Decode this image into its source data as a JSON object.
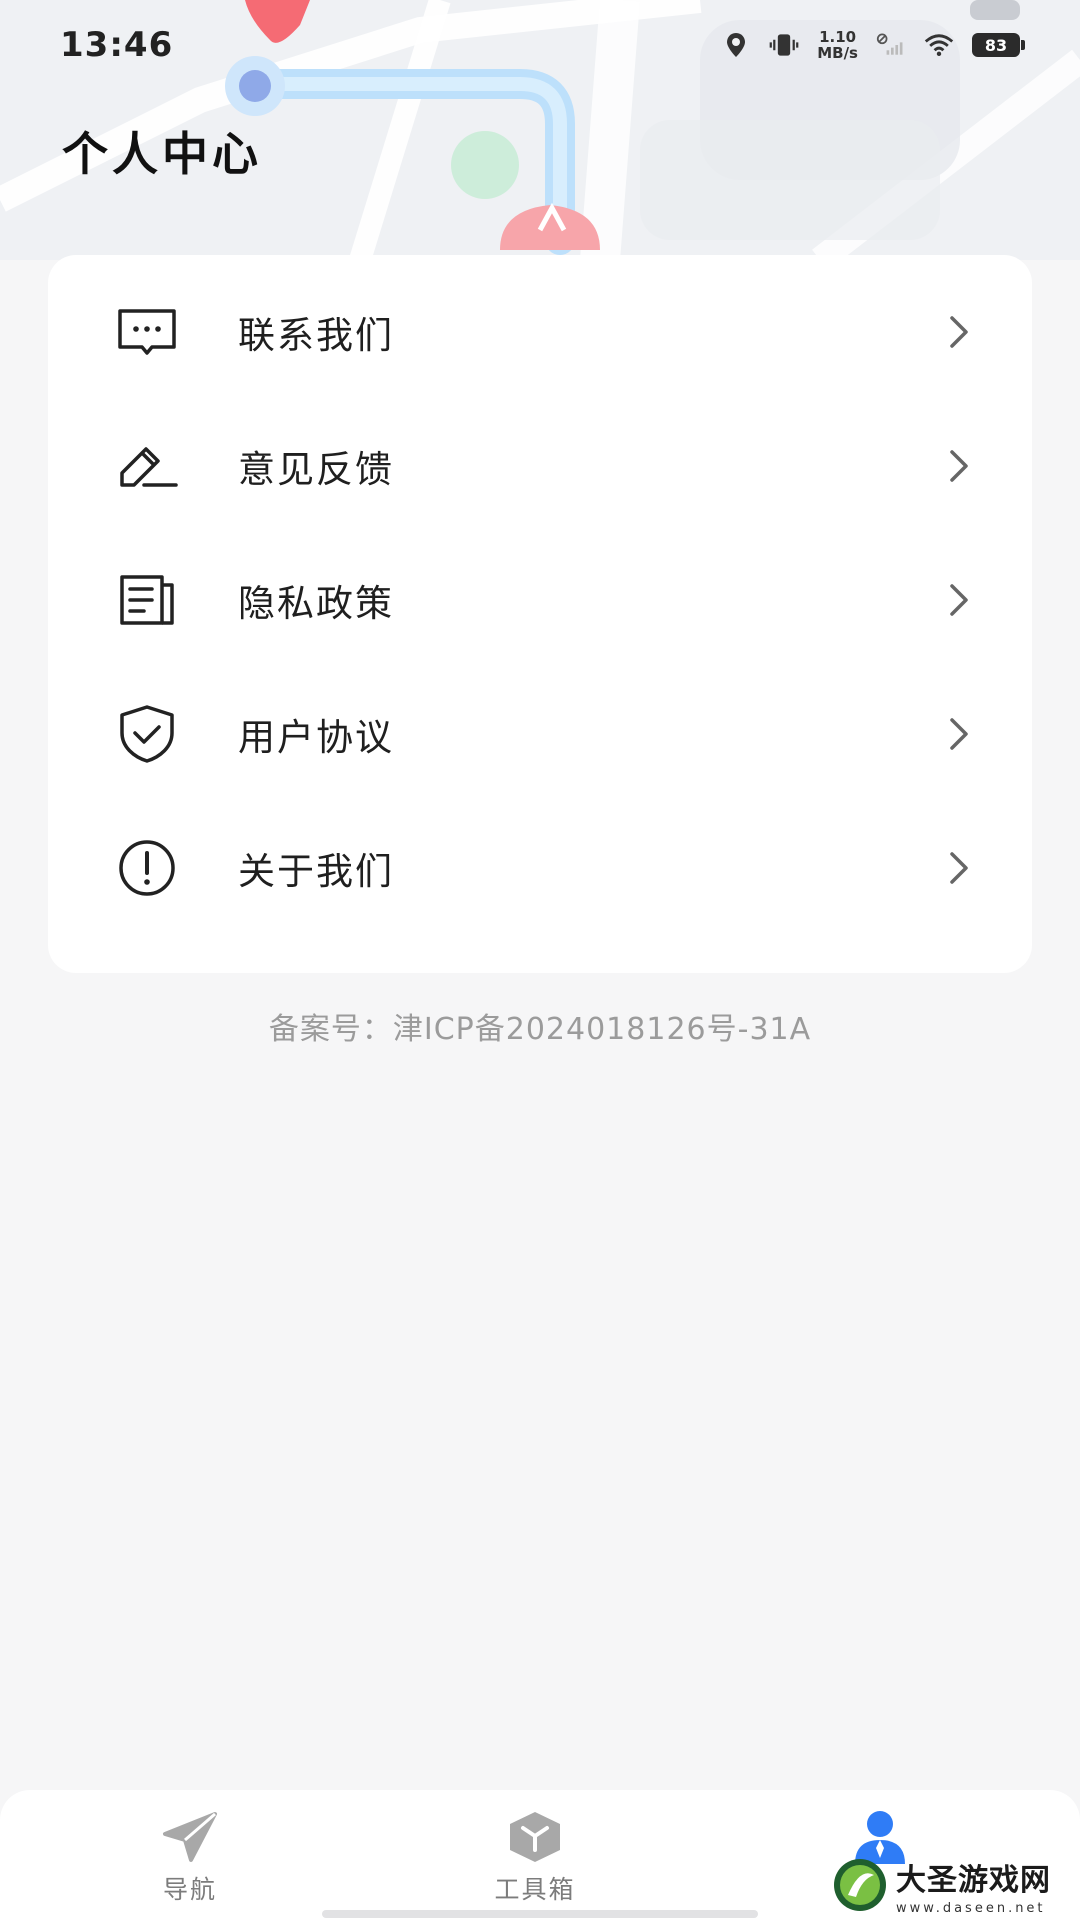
{
  "status_bar": {
    "time": "13:46",
    "net_speed_value": "1.10",
    "net_speed_unit": "MB/s",
    "battery": "83",
    "icons": [
      "location-icon",
      "vibrate-icon",
      "no-sim-signal-icon",
      "wifi-icon",
      "battery-icon"
    ]
  },
  "page": {
    "title": "个人中心"
  },
  "menu": {
    "items": [
      {
        "label": "联系我们",
        "icon": "message-icon"
      },
      {
        "label": "意见反馈",
        "icon": "edit-icon"
      },
      {
        "label": "隐私政策",
        "icon": "document-icon"
      },
      {
        "label": "用户协议",
        "icon": "shield-check-icon"
      },
      {
        "label": "关于我们",
        "icon": "info-exclamation-icon"
      }
    ]
  },
  "icp": "备案号：津ICP备2024018126号-31A",
  "bottom_nav": {
    "items": [
      {
        "label": "导航",
        "icon": "navigation-icon"
      },
      {
        "label": "工具箱",
        "icon": "toolbox-icon"
      },
      {
        "label": "",
        "icon": "profile-icon",
        "active": true
      }
    ]
  },
  "watermark": {
    "title": "大圣游戏网",
    "url": "www.daseen.net"
  },
  "colors": {
    "accent": "#2f7cf6",
    "background": "#f6f6f7",
    "card": "#ffffff",
    "muted": "#9b9b9b"
  }
}
